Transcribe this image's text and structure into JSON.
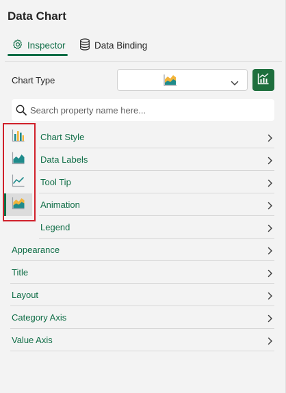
{
  "panel": {
    "title": "Data Chart"
  },
  "tabs": [
    {
      "label": "Inspector",
      "icon": "gear-icon",
      "active": true
    },
    {
      "label": "Data Binding",
      "icon": "database-icon",
      "active": false
    }
  ],
  "chart_type": {
    "label": "Chart Type",
    "selected_icon": "area-chart-icon",
    "button_icon": "combo-chart-icon"
  },
  "search": {
    "placeholder": "Search property name here...",
    "value": ""
  },
  "icon_rail": [
    {
      "icon": "bar-chart-icon",
      "active": false
    },
    {
      "icon": "area-chart-icon",
      "active": false
    },
    {
      "icon": "line-chart-icon",
      "active": false
    },
    {
      "icon": "stacked-area-chart-icon",
      "active": true
    }
  ],
  "sub_sections": [
    {
      "label": "Chart Style"
    },
    {
      "label": "Data Labels"
    },
    {
      "label": "Tool Tip"
    },
    {
      "label": "Animation"
    },
    {
      "label": "Legend"
    }
  ],
  "sections": [
    {
      "label": "Appearance"
    },
    {
      "label": "Title"
    },
    {
      "label": "Layout"
    },
    {
      "label": "Category Axis"
    },
    {
      "label": "Value Axis"
    }
  ],
  "colors": {
    "accent": "#0f6d46",
    "button_green": "#1e6f3d",
    "highlight": "#d0202a"
  }
}
